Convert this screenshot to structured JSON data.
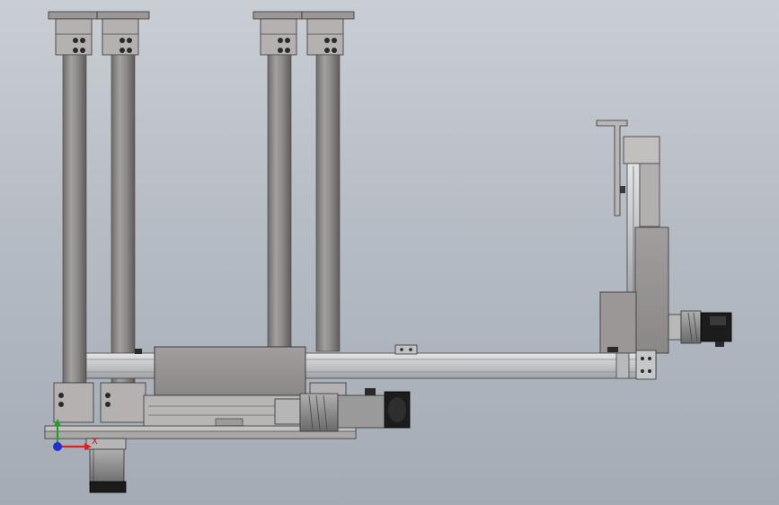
{
  "scene": {
    "background_top": "#c9ced4",
    "background_bottom": "#a4abb4",
    "part_gray": "#8e8b8a",
    "rail_color": "#c6c8cb",
    "motor_black": "#1a1a1a"
  },
  "triad": {
    "x_label": "X",
    "x_color": "#e02020",
    "y_color": "#20a020",
    "z_color": "#2030d0"
  }
}
